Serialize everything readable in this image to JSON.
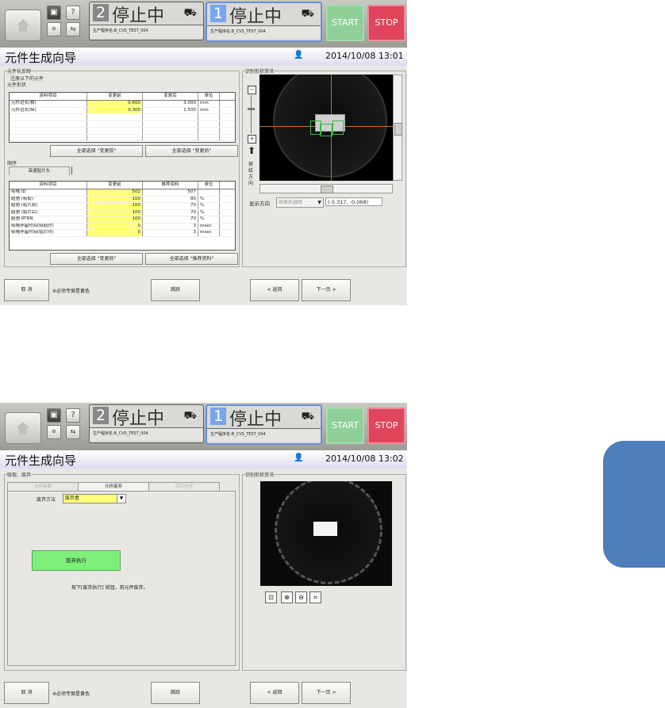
{
  "app": {
    "top_bar": {
      "lane2": {
        "number": "2",
        "state": "停止中",
        "program": "生产程序名:B_CVS_TEST_004"
      },
      "lane1": {
        "number": "1",
        "state": "停止中",
        "program": "生产程序名:B_CVS_TEST_004"
      },
      "help_glyph": "?",
      "start_label": "START",
      "stop_label": "STOP"
    },
    "screen1": {
      "title": "元件生成向导",
      "datetime": "2014/10/08 13:01",
      "section_a_label": "元件长反映",
      "section_a_note": "注册以下的元件",
      "shape_label": "元件形状",
      "shape_table": {
        "headers": [
          "资料项目",
          "变更前",
          "变更后",
          "单位"
        ],
        "rows": [
          [
            "元件边长(横)",
            "0.600",
            "3.000",
            "mm"
          ],
          [
            "元件边长(纵)",
            "0.300",
            "1.500",
            "mm"
          ]
        ]
      },
      "btn_select_before": "全部选择 \"变更前\"",
      "btn_select_after": "全部选择 \"变更后\"",
      "order_label": "顺序",
      "order_tab": "高速贴片头",
      "order_table": {
        "headers": [
          "资料项目",
          "变更前",
          "推荐资料",
          "单位"
        ],
        "rows": [
          [
            "吸嘴 ID",
            "502",
            "507",
            ""
          ],
          [
            "超驰 (吸取)",
            "100",
            "80",
            "%"
          ],
          [
            "超驰 (贴片前)",
            "100",
            "70",
            "%"
          ],
          [
            "超驰 (贴片后)",
            "100",
            "70",
            "%"
          ],
          [
            "超驰 RTRN",
            "100",
            "70",
            "%"
          ],
          [
            "吸嘴停留时间(吸取时)",
            "0",
            "3",
            "msec"
          ],
          [
            "吸嘴停留时间(贴片时)",
            "0",
            "3",
            "msec"
          ]
        ]
      },
      "btn_order_before": "全部选择 \"变更前\"",
      "btn_order_recommend": "全部选择 \"推荐资料\"",
      "recognition_label": "识别形状资讯",
      "feed_direction": "供给方向",
      "display_direction_label": "显示方向",
      "display_direction_value": "画像机器图",
      "coords": "(-5.317, -0.068)",
      "footer": {
        "cancel": "取 消",
        "note": "※必须专案是黄色",
        "skip": "跳跃",
        "back": "< 返回",
        "next": "下一页 >"
      }
    },
    "screen2": {
      "title": "元件生成向导",
      "datetime": "2014/10/08 13:02",
      "section_label": "吸取、废弃",
      "tabs": [
        "元件吸取",
        "元件废弃",
        "库存处理"
      ],
      "discard_method_label": "废弃方法",
      "discard_method_value": "废弃盒",
      "discard_button": "废弃执行",
      "discard_hint": "按下[废弃执行] 按钮，则元件废弃。",
      "recognition_label": "识别形状资讯",
      "footer": {
        "cancel": "取 消",
        "note": "※必须专案是黄色",
        "skip": "跳跃",
        "back": "< 返回",
        "next": "下一页 >"
      }
    }
  }
}
